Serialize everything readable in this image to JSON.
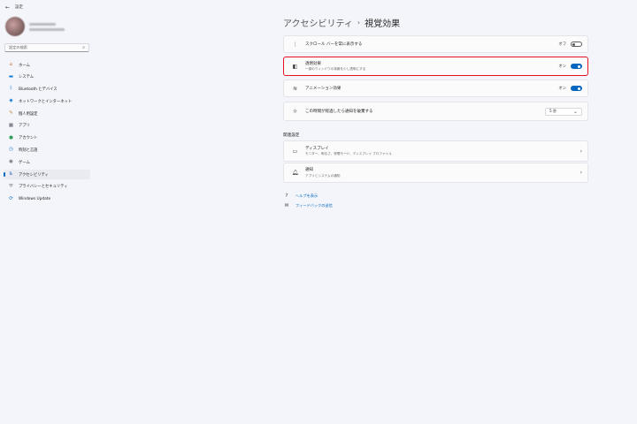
{
  "window": {
    "back_glyph": "←",
    "title": "設定"
  },
  "sidebar": {
    "search_placeholder": "設定の検索",
    "items": [
      {
        "label": "ホーム",
        "icon": "⌂",
        "icon_name": "home-icon",
        "color": "#c76b2a"
      },
      {
        "label": "システム",
        "icon": "▬",
        "icon_name": "system-icon",
        "color": "#0f7bd4"
      },
      {
        "label": "Bluetooth とデバイス",
        "icon": "ᛒ",
        "icon_name": "bluetooth-icon",
        "color": "#0f7bd4"
      },
      {
        "label": "ネットワークとインターネット",
        "icon": "◆",
        "icon_name": "network-icon",
        "color": "#2b88d8"
      },
      {
        "label": "個人用設定",
        "icon": "✎",
        "icon_name": "personalization-icon",
        "color": "#c7893a"
      },
      {
        "label": "アプリ",
        "icon": "▦",
        "icon_name": "apps-icon",
        "color": "#555a66"
      },
      {
        "label": "アカウント",
        "icon": "●",
        "icon_name": "account-icon",
        "color": "#2f9e5a"
      },
      {
        "label": "時刻と言語",
        "icon": "◷",
        "icon_name": "time-language-icon",
        "color": "#1a73c9"
      },
      {
        "label": "ゲーム",
        "icon": "◉",
        "icon_name": "gaming-icon",
        "color": "#6b6f7a"
      },
      {
        "label": "アクセシビリティ",
        "icon": "♿",
        "icon_name": "accessibility-icon",
        "color": "#1a5fb4",
        "active": true
      },
      {
        "label": "プライバシーとセキュリティ",
        "icon": "⛨",
        "icon_name": "privacy-shield-icon",
        "color": "#6b6f7a"
      },
      {
        "label": "Windows Update",
        "icon": "⟳",
        "icon_name": "windows-update-icon",
        "color": "#1a73c9"
      }
    ]
  },
  "header": {
    "parent": "アクセシビリティ",
    "separator": "›",
    "current": "視覚効果"
  },
  "settings": [
    {
      "title": "スクロール バーを常に表示する",
      "subtitle": "",
      "icon": "⋮",
      "icon_name": "scrollbar-icon",
      "state": "オフ",
      "on": false
    },
    {
      "title": "透明効果",
      "subtitle": "一部のウィンドウの背景を少し透明にする",
      "icon": "◧",
      "icon_name": "transparency-icon",
      "state": "オン",
      "on": true
    },
    {
      "title": "アニメーション効果",
      "subtitle": "",
      "icon": "≋",
      "icon_name": "animation-icon",
      "state": "オン",
      "on": true
    },
    {
      "title": "この時間が経過したら通知を破棄する",
      "subtitle": "",
      "icon": "☼",
      "icon_name": "notification-timer-icon",
      "dropdown": "5 秒"
    }
  ],
  "related": {
    "title": "関連設定",
    "items": [
      {
        "title": "ディスプレイ",
        "subtitle": "モニター、明るさ、夜間モード、ディスプレイ プロファイル",
        "icon": "▭",
        "icon_name": "display-icon"
      },
      {
        "title": "通知",
        "subtitle": "アプリとシステムの通知",
        "icon": "🔔︎",
        "icon_name": "notification-bell-icon"
      }
    ]
  },
  "links": [
    {
      "label": "ヘルプを表示",
      "icon": "?",
      "icon_name": "help-icon"
    },
    {
      "label": "フィードバックの送信",
      "icon": "✉",
      "icon_name": "feedback-icon"
    }
  ]
}
